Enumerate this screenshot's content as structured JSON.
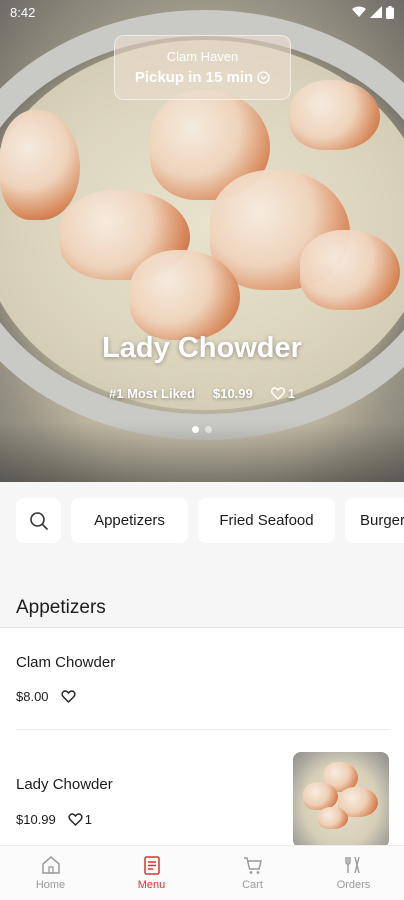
{
  "status_bar": {
    "time": "8:42"
  },
  "hero": {
    "store_name": "Clam Haven",
    "pickup_text": "Pickup in 15 min",
    "featured_title": "Lady Chowder",
    "featured_rank": "#1 Most Liked",
    "featured_price": "$10.99",
    "featured_likes": "1",
    "carousel_pages": 2,
    "carousel_active": 1
  },
  "categories": {
    "search_icon": "search-icon",
    "items": [
      "Appetizers",
      "Fried Seafood",
      "Burgers"
    ]
  },
  "section": {
    "title": "Appetizers"
  },
  "menu_items": [
    {
      "name": "Clam Chowder",
      "price": "$8.00",
      "likes": ""
    },
    {
      "name": "Lady Chowder",
      "price": "$10.99",
      "likes": "1"
    }
  ],
  "bottom_nav": {
    "items": [
      {
        "label": "Home",
        "icon": "home-icon"
      },
      {
        "label": "Menu",
        "icon": "menu-book-icon"
      },
      {
        "label": "Cart",
        "icon": "cart-icon"
      },
      {
        "label": "Orders",
        "icon": "orders-icon"
      }
    ],
    "active": "Menu"
  },
  "colors": {
    "accent": "#e0312b",
    "nav_inactive": "#9a9a9a",
    "band_bg": "#f6f6f6"
  }
}
